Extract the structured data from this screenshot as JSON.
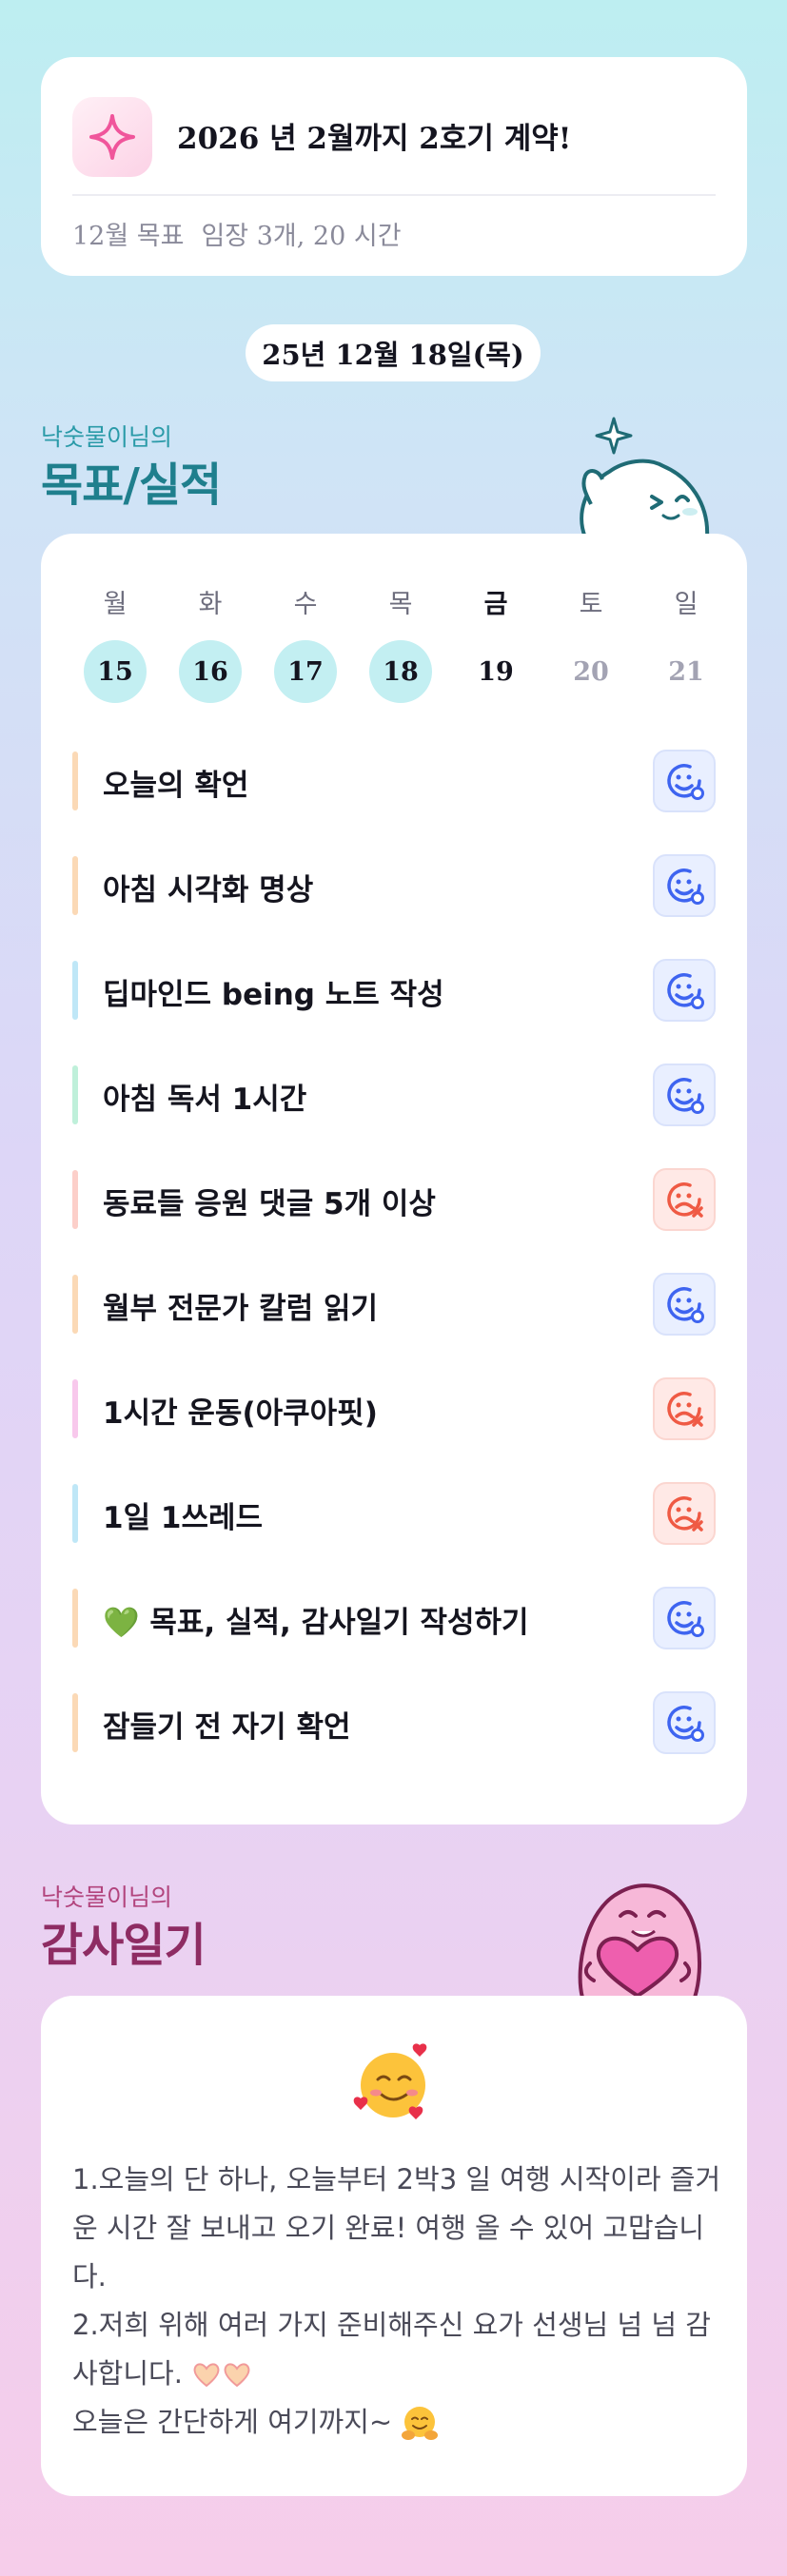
{
  "goal": {
    "title": "2026 년 2월까지 2호기 계약!",
    "month_label": "12월 목표",
    "month_goal": "임장 3개, 20 시간"
  },
  "date": "25년 12월 18일(목)",
  "goals_section": {
    "owner": "낙숫물이님의",
    "title": "목표/실적"
  },
  "week": [
    {
      "label": "월",
      "num": "15",
      "state": "done"
    },
    {
      "label": "화",
      "num": "16",
      "state": "done"
    },
    {
      "label": "수",
      "num": "17",
      "state": "done"
    },
    {
      "label": "목",
      "num": "18",
      "state": "done"
    },
    {
      "label": "금",
      "num": "19",
      "state": "today"
    },
    {
      "label": "토",
      "num": "20",
      "state": "future"
    },
    {
      "label": "일",
      "num": "21",
      "state": "future"
    }
  ],
  "checklist": [
    {
      "text": "오늘의 확언",
      "status": "ok",
      "bar": "#fbd9b6"
    },
    {
      "text": "아침 시각화 명상",
      "status": "ok",
      "bar": "#fbd9b6"
    },
    {
      "text": "딥마인드 being 노트 작성",
      "status": "ok",
      "bar": "#bfe7f7"
    },
    {
      "text": "아침 독서 1시간",
      "status": "ok",
      "bar": "#bff0da"
    },
    {
      "text": "동료들 응원 댓글 5개 이상",
      "status": "fail",
      "bar": "#fccfc9"
    },
    {
      "text": "월부 전문가 칼럼 읽기",
      "status": "ok",
      "bar": "#fbd9b6"
    },
    {
      "text": "1시간 운동(아쿠아핏)",
      "status": "fail",
      "bar": "#f8c8ec"
    },
    {
      "text": "1일 1쓰레드",
      "status": "fail",
      "bar": "#bfe7f7"
    },
    {
      "text": "💚 목표, 실적, 감사일기 작성하기",
      "status": "ok",
      "bar": "#fbd9b6"
    },
    {
      "text": "잠들기 전 자기 확언",
      "status": "ok",
      "bar": "#fbd9b6"
    }
  ],
  "thanks_section": {
    "owner": "낙숫물이님의",
    "title": "감사일기"
  },
  "thanks": {
    "line1": "1.오늘의 단 하나, 오늘부터 2박3 일 여행 시작이라 즐거운 시간 잘 보내고 오기 완료! 여행 올 수 있어 고맙습니다.",
    "line2": "2.저희 위해 여러 가지 준비해주신 요가 선생님 넘 넘 감사합니다.",
    "line3": "오늘은 간단하게 여기까지~"
  },
  "colors": {
    "accent_teal": "#2a9aa8",
    "accent_plum": "#b2447d",
    "status_ok": "#3e64f0",
    "status_fail": "#ef5a44"
  },
  "icons": {
    "goal": "sparkle-icon",
    "ok": "smile-face-icon",
    "fail": "sad-face-icon",
    "thanks": "smiling-face-with-hearts-icon"
  }
}
